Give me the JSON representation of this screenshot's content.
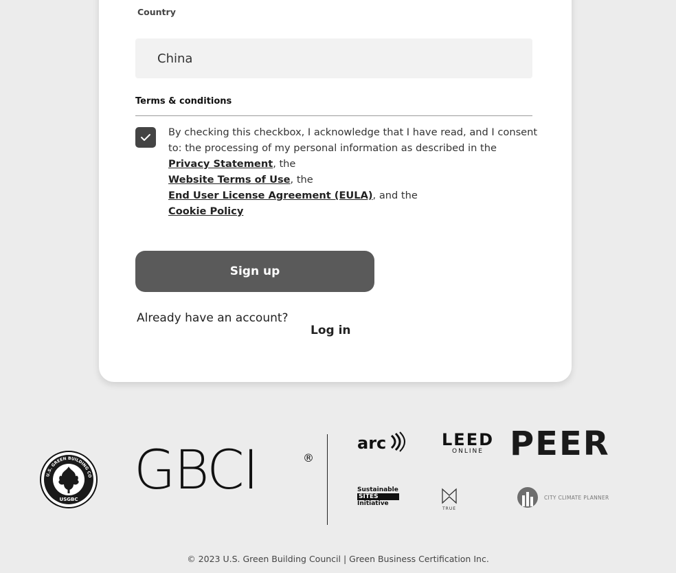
{
  "form": {
    "country_label": "Country",
    "country_value": "China",
    "terms_heading": "Terms & conditions",
    "consent_text_1": "By checking this checkbox, I acknowledge that I have read, and I consent to: the processing of my personal information as described in the ",
    "privacy_link": "Privacy Statement",
    "consent_text_2": ", the ",
    "website_terms_link": "Website Terms of Use",
    "consent_text_3": ", the ",
    "eula_link": "End User License Agreement (EULA)",
    "consent_text_4": ", and the ",
    "cookie_link": "Cookie Policy",
    "checkbox_checked": true,
    "signup_label": "Sign up",
    "already_text": "Already have an account?",
    "login_label": "Log in"
  },
  "footer": {
    "usgbc_ring_text": "U.S. GREEN BUILDING COUNCIL",
    "usgbc_text": "USGBC",
    "gbci_text": "GBCI",
    "gbci_reg": "®",
    "arc_text": "arc",
    "leed_big": "LEED",
    "leed_small": "ONLINE",
    "peer_text": "PEER",
    "sites_line1": "Sustainable",
    "sites_line2": "SITES",
    "sites_line3": "Initiative",
    "true_text": "TRUE",
    "ccp_text": "CITY CLIMATE PLANNER",
    "copyright": "© 2023 U.S. Green Building Council | Green Business Certification Inc."
  },
  "colors": {
    "page_bg": "#ececec",
    "card_bg": "#ffffff",
    "button_bg": "#5a5a5a",
    "checkbox_bg": "#444444"
  }
}
